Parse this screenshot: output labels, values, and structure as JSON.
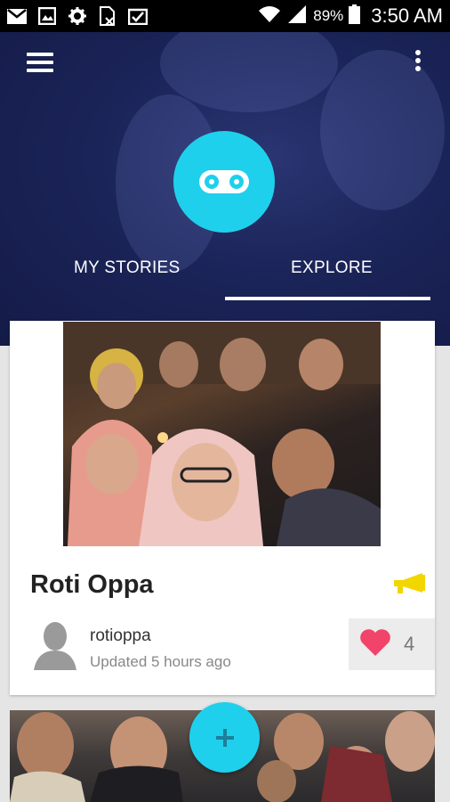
{
  "status_bar": {
    "battery": "89%",
    "time": "3:50 AM",
    "icons": [
      "gmail-icon",
      "image-icon",
      "settings-icon",
      "no-sim-icon",
      "clipboard-check-icon",
      "wifi-icon",
      "signal-icon",
      "battery-icon"
    ]
  },
  "header": {
    "menu_icon": "hamburger-menu-icon",
    "overflow_icon": "more-vert-icon",
    "logo_icon": "binoculars-icon",
    "tabs": [
      {
        "label": "MY STORIES",
        "selected": false
      },
      {
        "label": "EXPLORE",
        "selected": true
      }
    ]
  },
  "feed": {
    "cards": [
      {
        "title": "Roti Oppa",
        "category_icon": "megaphone-icon",
        "username": "rotioppa",
        "updated": "Updated 5 hours ago",
        "likes": "4"
      }
    ]
  },
  "fab": {
    "icon": "plus-icon",
    "label": "+"
  },
  "colors": {
    "accent": "#1fd0ec",
    "header_bg": "#1b2458",
    "heart": "#f2436a",
    "megaphone": "#f2d600",
    "background": "#e5e5e5"
  }
}
